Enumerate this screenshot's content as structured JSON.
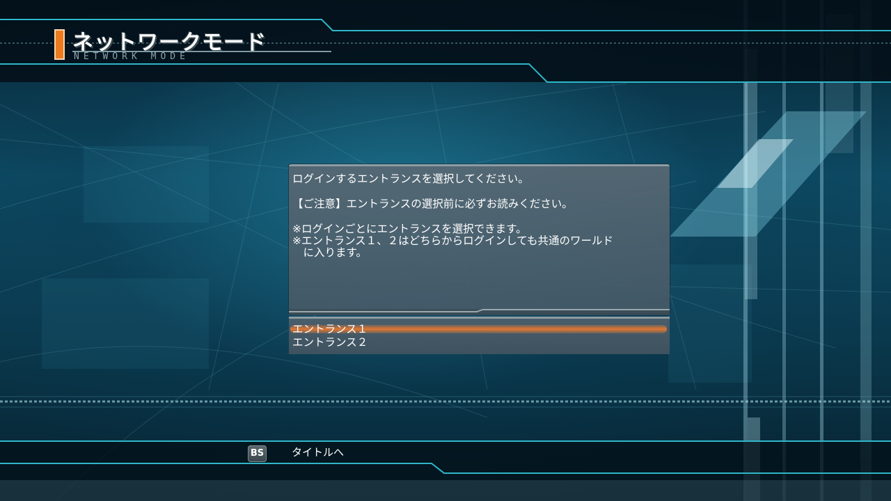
{
  "header": {
    "title": "ネットワークモード",
    "subtitle": "NETWORK MODE"
  },
  "info_panel": {
    "line1": "ログインするエントランスを選択してください。",
    "line2": "【ご注意】エントランスの選択前に必ずお読みください。",
    "line3": "※ログインごとにエントランスを選択できます。",
    "line4": "※エントランス１、２はどちらからログインしても共通のワールド",
    "line5": "　に入ります。"
  },
  "entrances": [
    {
      "label": "エントランス１",
      "selected": true
    },
    {
      "label": "エントランス２",
      "selected": false
    }
  ],
  "footer": {
    "key": "BS",
    "action": "タイトルへ"
  },
  "colors": {
    "accent": "#ee7a1e",
    "panel": "#5a6c78",
    "cyan_line": "#2fb6c8"
  }
}
